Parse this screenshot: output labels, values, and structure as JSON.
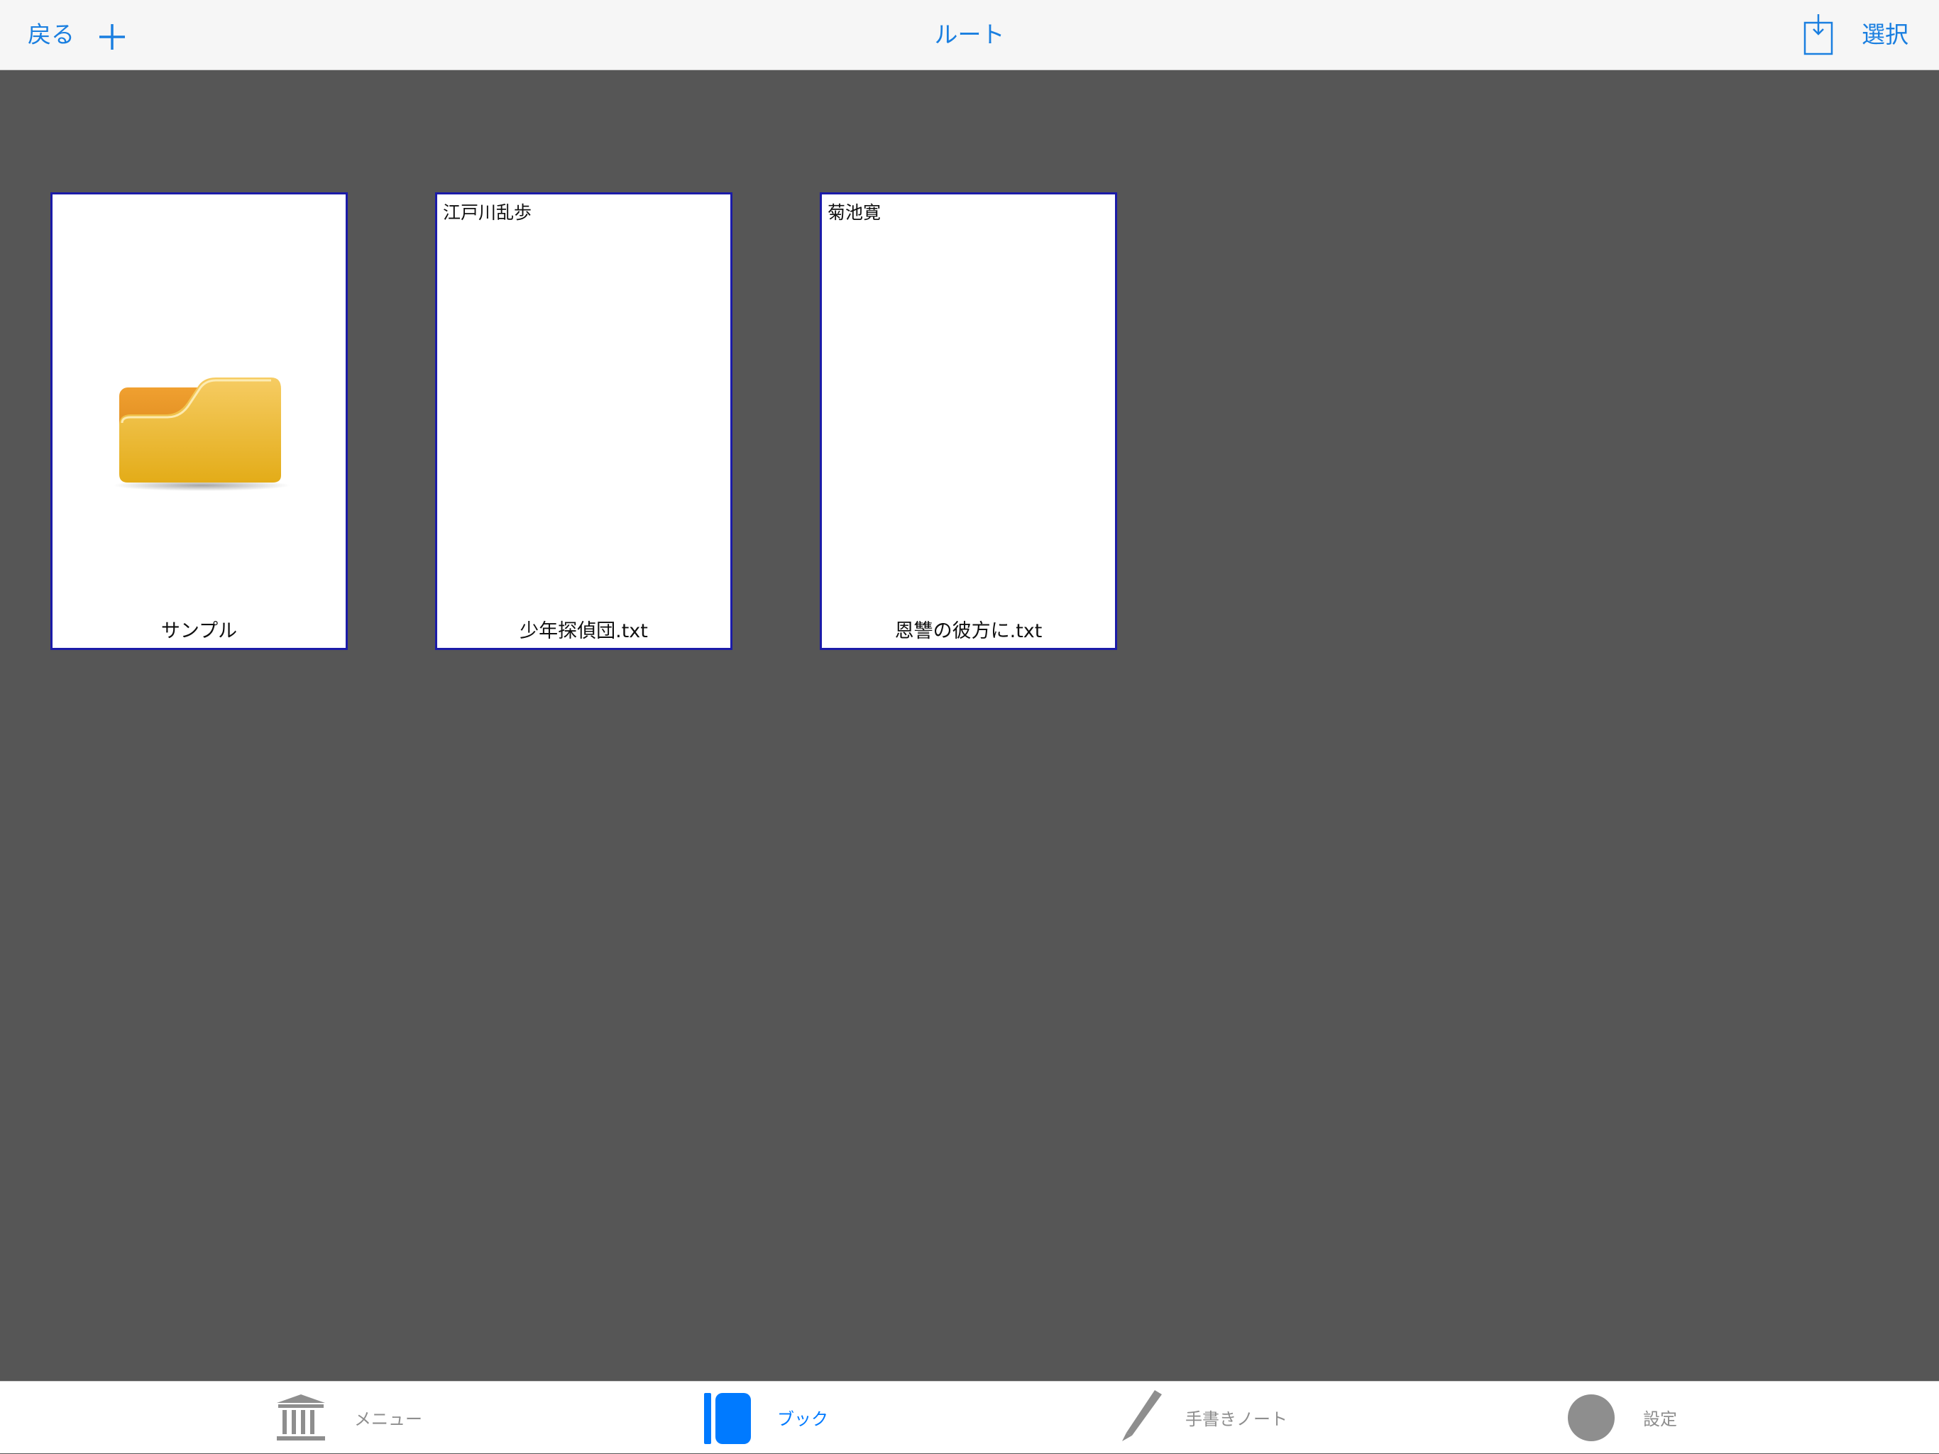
{
  "nav": {
    "back_label": "戻る",
    "title": "ルート",
    "select_label": "選択"
  },
  "items": [
    {
      "type": "folder",
      "author": "",
      "name": "サンプル"
    },
    {
      "type": "text-file",
      "author": "江戸川乱歩",
      "name": "少年探偵団.txt"
    },
    {
      "type": "text-file",
      "author": "菊池寛",
      "name": "恩讐の彼方に.txt"
    }
  ],
  "tabs": [
    {
      "label": "メニュー",
      "icon": "library-icon",
      "selected": false
    },
    {
      "label": "ブック",
      "icon": "book-icon",
      "selected": true
    },
    {
      "label": "手書きノート",
      "icon": "pencil-icon",
      "selected": false
    },
    {
      "label": "設定",
      "icon": "settings-icon",
      "selected": false
    }
  ],
  "colors": {
    "accent": "#1a7fe0",
    "tab_selected": "#007aff",
    "tab_inactive": "#8e8e8e",
    "background": "#565656",
    "card_border": "#1b1ba8"
  }
}
